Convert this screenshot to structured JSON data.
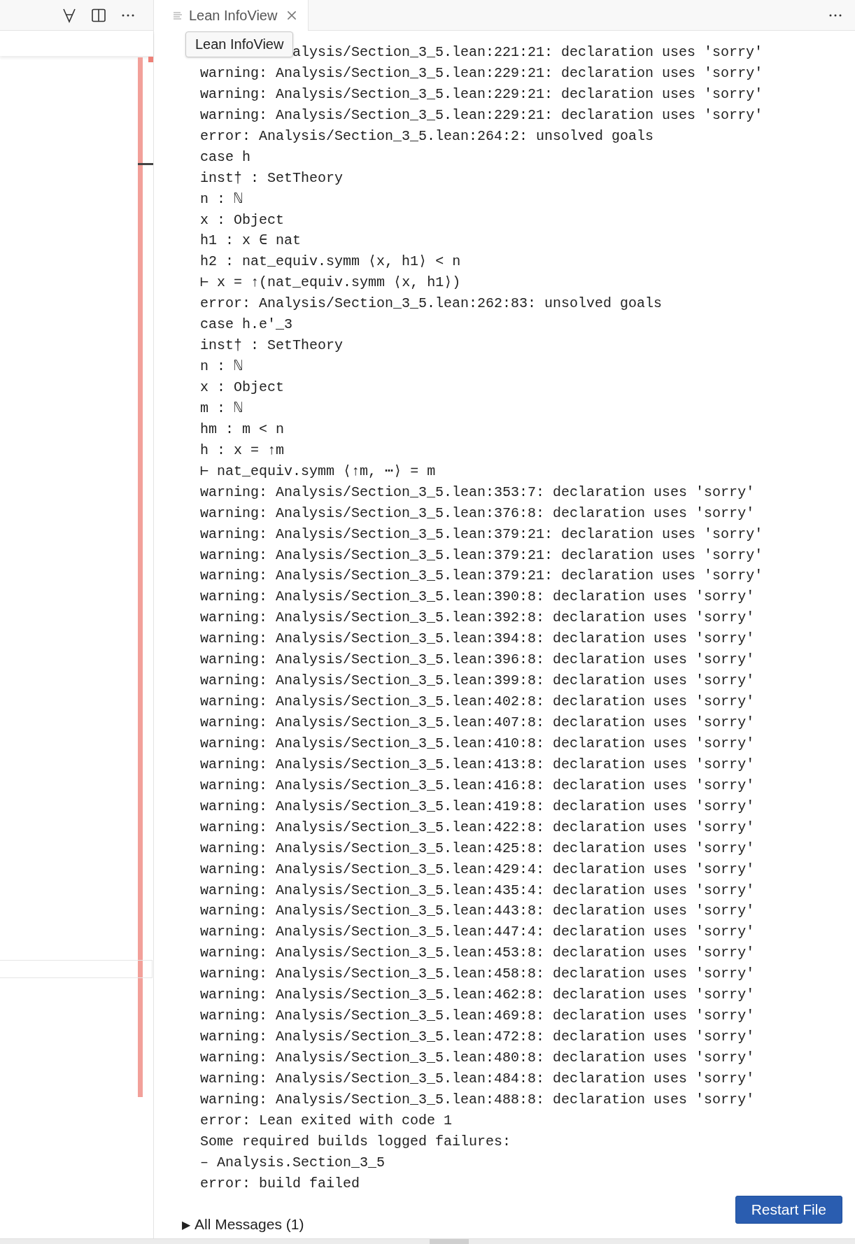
{
  "tab": {
    "label": "Lean InfoView",
    "selected": true
  },
  "tooltip": "Lean InfoView",
  "messages": [
    {
      "kind": "covered",
      "text": "alysis/Section_3_5.lean:221:21: declaration uses 'sorry'"
    },
    {
      "kind": "line",
      "text": "warning: Analysis/Section_3_5.lean:229:21: declaration uses 'sorry'"
    },
    {
      "kind": "line",
      "text": "warning: Analysis/Section_3_5.lean:229:21: declaration uses 'sorry'"
    },
    {
      "kind": "line",
      "text": "warning: Analysis/Section_3_5.lean:229:21: declaration uses 'sorry'"
    },
    {
      "kind": "line",
      "text": "error: Analysis/Section_3_5.lean:264:2: unsolved goals"
    },
    {
      "kind": "line",
      "text": "case h"
    },
    {
      "kind": "line",
      "text": "inst† : SetTheory"
    },
    {
      "kind": "line",
      "text": "n : ℕ"
    },
    {
      "kind": "line",
      "text": "x : Object"
    },
    {
      "kind": "line",
      "text": "h1 : x ∈ nat"
    },
    {
      "kind": "line",
      "text": "h2 : nat_equiv.symm ⟨x, h1⟩ < n"
    },
    {
      "kind": "line",
      "text": "⊢ x = ↑(nat_equiv.symm ⟨x, h1⟩)"
    },
    {
      "kind": "line",
      "text": "error: Analysis/Section_3_5.lean:262:83: unsolved goals"
    },
    {
      "kind": "line",
      "text": "case h.e'_3"
    },
    {
      "kind": "line",
      "text": "inst† : SetTheory"
    },
    {
      "kind": "line",
      "text": "n : ℕ"
    },
    {
      "kind": "line",
      "text": "x : Object"
    },
    {
      "kind": "line",
      "text": "m : ℕ"
    },
    {
      "kind": "line",
      "text": "hm : m < n"
    },
    {
      "kind": "line",
      "text": "h : x = ↑m"
    },
    {
      "kind": "line",
      "text": "⊢ nat_equiv.symm ⟨↑m, ⋯⟩ = m"
    },
    {
      "kind": "line",
      "text": "warning: Analysis/Section_3_5.lean:353:7: declaration uses 'sorry'"
    },
    {
      "kind": "line",
      "text": "warning: Analysis/Section_3_5.lean:376:8: declaration uses 'sorry'"
    },
    {
      "kind": "line",
      "text": "warning: Analysis/Section_3_5.lean:379:21: declaration uses 'sorry'"
    },
    {
      "kind": "line",
      "text": "warning: Analysis/Section_3_5.lean:379:21: declaration uses 'sorry'"
    },
    {
      "kind": "line",
      "text": "warning: Analysis/Section_3_5.lean:379:21: declaration uses 'sorry'"
    },
    {
      "kind": "line",
      "text": "warning: Analysis/Section_3_5.lean:390:8: declaration uses 'sorry'"
    },
    {
      "kind": "line",
      "text": "warning: Analysis/Section_3_5.lean:392:8: declaration uses 'sorry'"
    },
    {
      "kind": "line",
      "text": "warning: Analysis/Section_3_5.lean:394:8: declaration uses 'sorry'"
    },
    {
      "kind": "line",
      "text": "warning: Analysis/Section_3_5.lean:396:8: declaration uses 'sorry'"
    },
    {
      "kind": "line",
      "text": "warning: Analysis/Section_3_5.lean:399:8: declaration uses 'sorry'"
    },
    {
      "kind": "line",
      "text": "warning: Analysis/Section_3_5.lean:402:8: declaration uses 'sorry'"
    },
    {
      "kind": "line",
      "text": "warning: Analysis/Section_3_5.lean:407:8: declaration uses 'sorry'"
    },
    {
      "kind": "line",
      "text": "warning: Analysis/Section_3_5.lean:410:8: declaration uses 'sorry'"
    },
    {
      "kind": "line",
      "text": "warning: Analysis/Section_3_5.lean:413:8: declaration uses 'sorry'"
    },
    {
      "kind": "line",
      "text": "warning: Analysis/Section_3_5.lean:416:8: declaration uses 'sorry'"
    },
    {
      "kind": "line",
      "text": "warning: Analysis/Section_3_5.lean:419:8: declaration uses 'sorry'"
    },
    {
      "kind": "line",
      "text": "warning: Analysis/Section_3_5.lean:422:8: declaration uses 'sorry'"
    },
    {
      "kind": "line",
      "text": "warning: Analysis/Section_3_5.lean:425:8: declaration uses 'sorry'"
    },
    {
      "kind": "line",
      "text": "warning: Analysis/Section_3_5.lean:429:4: declaration uses 'sorry'"
    },
    {
      "kind": "line",
      "text": "warning: Analysis/Section_3_5.lean:435:4: declaration uses 'sorry'"
    },
    {
      "kind": "line",
      "text": "warning: Analysis/Section_3_5.lean:443:8: declaration uses 'sorry'"
    },
    {
      "kind": "line",
      "text": "warning: Analysis/Section_3_5.lean:447:4: declaration uses 'sorry'"
    },
    {
      "kind": "line",
      "text": "warning: Analysis/Section_3_5.lean:453:8: declaration uses 'sorry'"
    },
    {
      "kind": "line",
      "text": "warning: Analysis/Section_3_5.lean:458:8: declaration uses 'sorry'"
    },
    {
      "kind": "line",
      "text": "warning: Analysis/Section_3_5.lean:462:8: declaration uses 'sorry'"
    },
    {
      "kind": "line",
      "text": "warning: Analysis/Section_3_5.lean:469:8: declaration uses 'sorry'"
    },
    {
      "kind": "line",
      "text": "warning: Analysis/Section_3_5.lean:472:8: declaration uses 'sorry'"
    },
    {
      "kind": "line",
      "text": "warning: Analysis/Section_3_5.lean:480:8: declaration uses 'sorry'"
    },
    {
      "kind": "line",
      "text": "warning: Analysis/Section_3_5.lean:484:8: declaration uses 'sorry'"
    },
    {
      "kind": "line",
      "text": "warning: Analysis/Section_3_5.lean:488:8: declaration uses 'sorry'"
    },
    {
      "kind": "line",
      "text": "error: Lean exited with code 1"
    },
    {
      "kind": "line",
      "text": "Some required builds logged failures:"
    },
    {
      "kind": "line",
      "text": "– Analysis.Section_3_5"
    },
    {
      "kind": "line",
      "text": "error: build failed"
    }
  ],
  "all_messages": {
    "toggle": "▶",
    "label": "All Messages (1)",
    "expanded": false
  },
  "restart_button": "Restart File"
}
